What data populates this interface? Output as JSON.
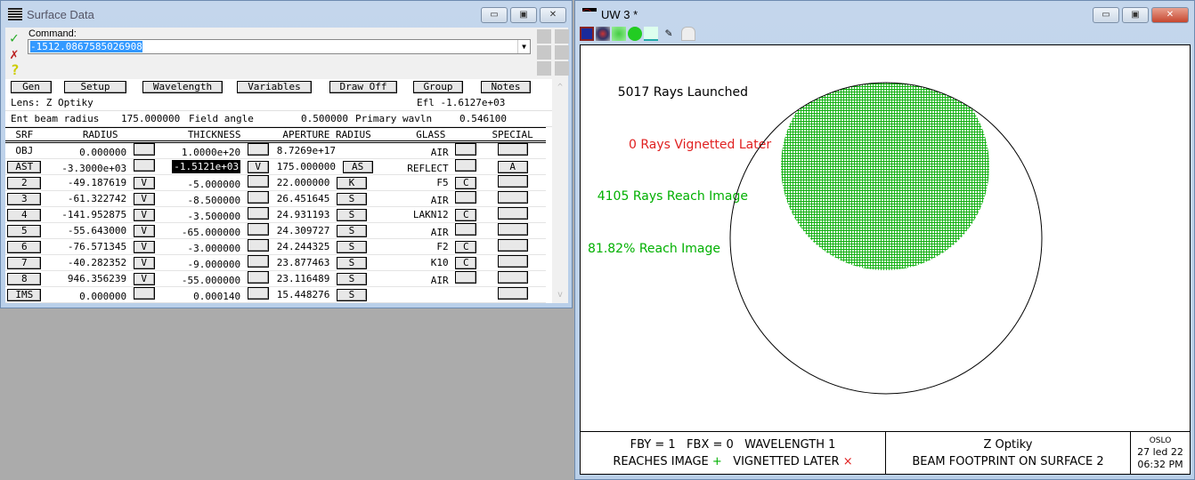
{
  "surface_window": {
    "title": "Surface Data",
    "command_label": "Command:",
    "command_value": "-1512.0867585026908",
    "buttons": [
      "Gen",
      "Setup",
      "Wavelength",
      "Variables",
      "Draw Off",
      "Group",
      "Notes"
    ],
    "lens": "Lens: Z Optiky",
    "efl": "Efl -1.6127e+03",
    "ent_beam_label": "Ent beam radius",
    "ent_beam": "175.000000",
    "field_label": "Field angle",
    "field": "0.500000",
    "wavln_label": "Primary wavln",
    "wavln": "0.546100",
    "columns": [
      "SRF",
      "RADIUS",
      "THICKNESS",
      "APERTURE RADIUS",
      "GLASS",
      "SPECIAL"
    ],
    "rows": [
      {
        "srf": "OBJ",
        "radius": "0.000000",
        "rflag": "",
        "thickness": "1.0000e+20",
        "tflag": "",
        "aperture": "8.7269e+17",
        "aflag": null,
        "glass": "AIR",
        "gflag": "",
        "special": ""
      },
      {
        "srf": "AST",
        "radius": "-3.3000e+03",
        "rflag": "",
        "thickness": "-1.5121e+03",
        "tflag": "V",
        "aperture": "175.000000",
        "aflag": "AS",
        "glass": "REFLECT",
        "gflag": "",
        "special": "A"
      },
      {
        "srf": "2",
        "radius": "-49.187619",
        "rflag": "V",
        "thickness": "-5.000000",
        "tflag": "",
        "aperture": "22.000000",
        "aflag": "K",
        "glass": "F5",
        "gflag": "C",
        "special": ""
      },
      {
        "srf": "3",
        "radius": "-61.322742",
        "rflag": "V",
        "thickness": "-8.500000",
        "tflag": "",
        "aperture": "26.451645",
        "aflag": "S",
        "glass": "AIR",
        "gflag": "",
        "special": ""
      },
      {
        "srf": "4",
        "radius": "-141.952875",
        "rflag": "V",
        "thickness": "-3.500000",
        "tflag": "",
        "aperture": "24.931193",
        "aflag": "S",
        "glass": "LAKN12",
        "gflag": "C",
        "special": ""
      },
      {
        "srf": "5",
        "radius": "-55.643000",
        "rflag": "V",
        "thickness": "-65.000000",
        "tflag": "",
        "aperture": "24.309727",
        "aflag": "S",
        "glass": "AIR",
        "gflag": "",
        "special": ""
      },
      {
        "srf": "6",
        "radius": "-76.571345",
        "rflag": "V",
        "thickness": "-3.000000",
        "tflag": "",
        "aperture": "24.244325",
        "aflag": "S",
        "glass": "F2",
        "gflag": "C",
        "special": ""
      },
      {
        "srf": "7",
        "radius": "-40.282352",
        "rflag": "V",
        "thickness": "-9.000000",
        "tflag": "",
        "aperture": "23.877463",
        "aflag": "S",
        "glass": "K10",
        "gflag": "C",
        "special": ""
      },
      {
        "srf": "8",
        "radius": "946.356239",
        "rflag": "V",
        "thickness": "-55.000000",
        "tflag": "",
        "aperture": "23.116489",
        "aflag": "S",
        "glass": "AIR",
        "gflag": "",
        "special": ""
      },
      {
        "srf": "IMS",
        "radius": "0.000000",
        "rflag": "",
        "thickness": "0.000140",
        "tflag": "",
        "aperture": "15.448276",
        "aflag": "S",
        "glass": null,
        "gflag": null,
        "special": ""
      }
    ]
  },
  "plot_window": {
    "title": "UW 3 *",
    "stats": {
      "launched": "5017 Rays Launched",
      "vignetted": "0 Rays Vignetted Later",
      "reach": "4105 Rays Reach Image",
      "percent": "81.82% Reach Image"
    },
    "footer": {
      "line1": "FBY = 1   FBX = 0   WAVELENGTH 1",
      "reaches": "REACHES IMAGE",
      "plus": "+",
      "vig": "VIGNETTED LATER",
      "x": "×",
      "lens": "Z Optiky",
      "desc": "BEAM FOOTPRINT ON SURFACE 2",
      "program": "OSLO",
      "date": "27 led 22",
      "time": "06:32 PM"
    },
    "colors": {
      "reach": "#00b000",
      "vignetted": "#e02020"
    }
  }
}
